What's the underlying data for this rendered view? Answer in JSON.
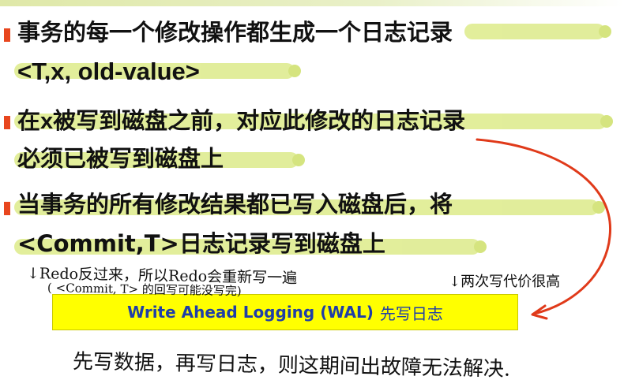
{
  "slide": {
    "bullet1": {
      "line1": "事务的每一个修改操作都生成一个日志记录",
      "line2": "<T,x, old-value>"
    },
    "bullet2": {
      "line1_a": "在",
      "line1_b": "x",
      "line1_c": "被写到磁盘之前，对应此修改的日志记录",
      "line2": "必须已被写到磁盘上"
    },
    "bullet3": {
      "line1": "当事务的所有修改结果都已写入磁盘后，将",
      "line2": "<Commit,T>日志记录写到磁盘上"
    },
    "wal_box": {
      "text_en": "Write Ahead Logging (WAL)",
      "text_cn": "先写日志"
    }
  },
  "annotations": {
    "note1": "↓Redo反过来，所以Redo会重新写一遍",
    "note2": "( <Commit, T> 的回写可能没写完)",
    "note3": "↓两次写代价很高",
    "note4": "先写数据，再写日志，则这期间出故障无法解决."
  },
  "colors": {
    "marker": "#e8461e",
    "highlight": "#d8e87a",
    "box_bg": "#ffff00",
    "box_text": "#1f3ea8",
    "arrow": "#e03a1a"
  }
}
